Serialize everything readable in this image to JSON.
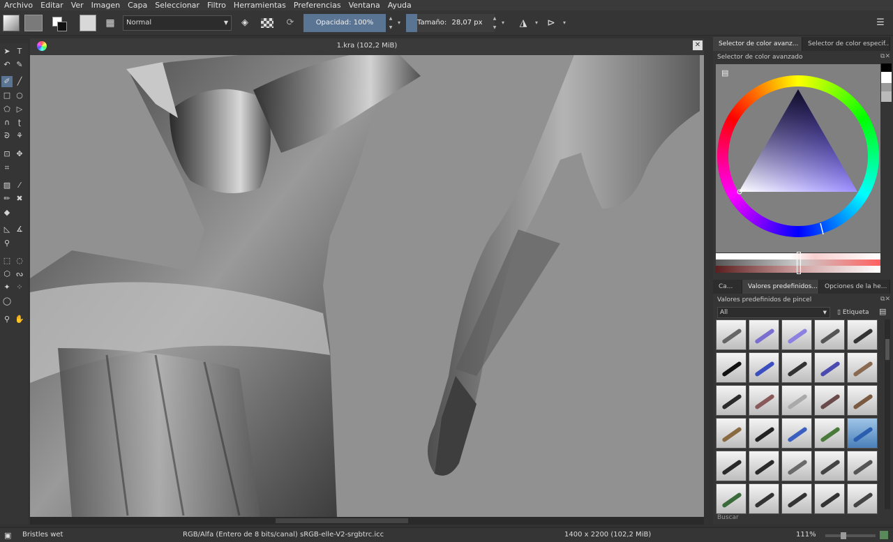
{
  "menu": [
    "Archivo",
    "Editar",
    "Ver",
    "Imagen",
    "Capa",
    "Seleccionar",
    "Filtro",
    "Herramientas",
    "Preferencias",
    "Ventana",
    "Ayuda"
  ],
  "toolbar": {
    "blend_mode": "Normal",
    "opacity_label": "Opacidad:",
    "opacity_value": "100%",
    "size_label": "Tamaño:",
    "size_value": "28,07 px"
  },
  "document": {
    "title": "1.kra (102,2 MiB)"
  },
  "dock": {
    "color_tabs": [
      "Selector de color avanz...",
      "Selector de color especif..."
    ],
    "color_panel_title": "Selector de color avanzado",
    "preset_tabs": [
      "Ca...",
      "Valores predefinidos...",
      "Opciones de la he..."
    ],
    "preset_panel_title": "Valores predefinidos de pincel",
    "filter_value": "All",
    "tag_label": "Etiqueta",
    "search_label": "Buscar",
    "preset_count": 30,
    "selected_preset": 19
  },
  "status": {
    "brush": "Bristles wet",
    "color_model": "RGB/Alfa (Entero de 8 bits/canal)  sRGB-elle-V2-srgbtrc.icc",
    "dimensions": "1400 x 2200 (102,2 MiB)",
    "zoom": "111%"
  },
  "colors": {
    "accent": "#5a7594",
    "canvas_bg": "#919191"
  }
}
